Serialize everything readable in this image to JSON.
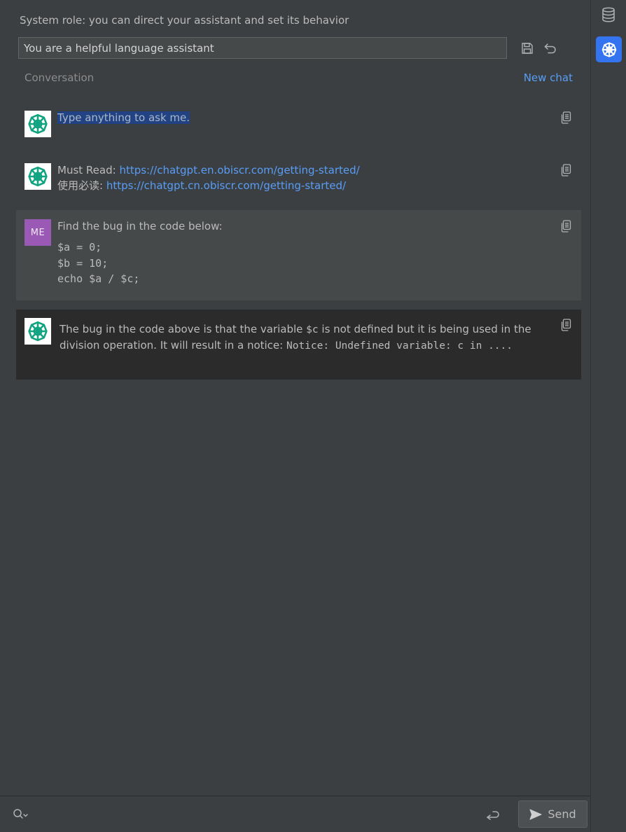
{
  "system_role": {
    "label": "System role: you can direct your assistant and set its behavior",
    "value": "You are a helpful language assistant"
  },
  "conversation": {
    "label": "Conversation",
    "new_chat": "New chat"
  },
  "messages": [
    {
      "author": "bot",
      "text": "Type anything to ask me."
    },
    {
      "author": "bot",
      "line1_prefix": "Must Read: ",
      "line1_link": "https://chatgpt.en.obiscr.com/getting-started/",
      "line2_prefix": "使用必读: ",
      "line2_link": "https://chatgpt.cn.obiscr.com/getting-started/"
    },
    {
      "author": "ME",
      "text": "Find the bug in the code below:",
      "code": [
        "$a = 0;",
        "$b = 10;",
        "echo $a / $c;"
      ]
    },
    {
      "author": "bot",
      "text_1": "The bug in the code above is that the variable ",
      "code_1": "$c",
      "text_2": " is not defined but it is being used in the division operation. It will result in a notice: ",
      "code_2": "Notice: Undefined variable: c in ...."
    }
  ],
  "send": {
    "label": "Send"
  },
  "icons": {
    "save": "save-icon",
    "undo": "undo-icon",
    "copy": "copy-icon",
    "database": "database-icon",
    "chatgpt": "chatgpt-logo-icon",
    "search": "search-icon",
    "enter": "enter-icon",
    "send": "send-icon"
  },
  "colors": {
    "accent": "#589df6",
    "panel": "#3c3f41",
    "user_message": "#45494a",
    "assistant_dark": "#2b2b2b",
    "avatar_me": "#9b59b6",
    "logo_green": "#10a37f",
    "active_tool": "#3574f0"
  }
}
